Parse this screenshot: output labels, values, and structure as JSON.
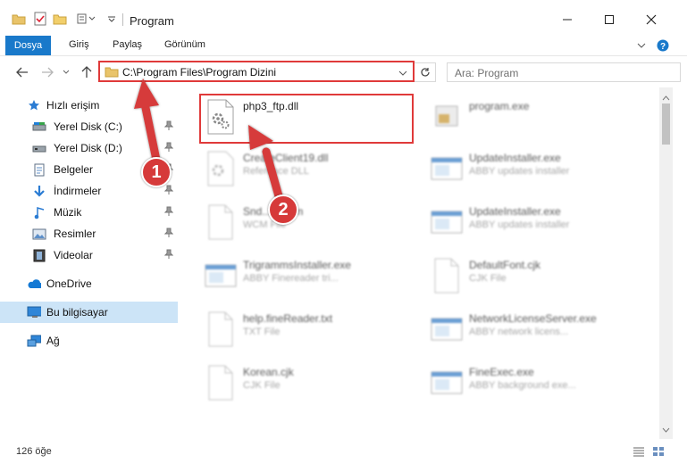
{
  "window": {
    "title": "Program",
    "controls": {
      "minimize": "minimize-icon",
      "maximize": "maximize-icon",
      "close": "close-icon"
    }
  },
  "ribbon": {
    "tabs": [
      "Dosya",
      "Giriş",
      "Paylaş",
      "Görünüm"
    ]
  },
  "address": {
    "path": "C:\\Program Files\\Program Dizini"
  },
  "search": {
    "placeholder": "Ara: Program"
  },
  "sidebar": {
    "items": [
      {
        "label": "Hızlı erişim",
        "icon": "star-icon",
        "pinned": false
      },
      {
        "label": "Yerel Disk (C:)",
        "icon": "drive-icon",
        "pinned": true
      },
      {
        "label": "Yerel Disk (D:)",
        "icon": "drive-icon",
        "pinned": true
      },
      {
        "label": "Belgeler",
        "icon": "document-icon",
        "pinned": true
      },
      {
        "label": "İndirmeler",
        "icon": "download-icon",
        "pinned": true
      },
      {
        "label": "Müzik",
        "icon": "music-icon",
        "pinned": true
      },
      {
        "label": "Resimler",
        "icon": "picture-icon",
        "pinned": true
      },
      {
        "label": "Videolar",
        "icon": "video-icon",
        "pinned": true
      },
      {
        "label": "OneDrive",
        "icon": "cloud-icon",
        "pinned": false
      },
      {
        "label": "Bu bilgisayar",
        "icon": "computer-icon",
        "pinned": false
      },
      {
        "label": "Ağ",
        "icon": "network-icon",
        "pinned": false
      }
    ]
  },
  "files": [
    {
      "name": "php3_ftp.dll",
      "desc": "",
      "icon": "dll-gear-icon"
    },
    {
      "name": "program.exe",
      "desc": "",
      "icon": "exe-icon"
    },
    {
      "name": "CreateClient19.dll",
      "desc": "Reference DLL",
      "icon": "dll-gear-icon"
    },
    {
      "name": "UpdateInstaller.exe",
      "desc": "ABBY updates installer",
      "icon": "window-exe-icon"
    },
    {
      "name": "Snd...S.wcm",
      "desc": "WCM File",
      "icon": "file-icon"
    },
    {
      "name": "UpdateInstaller.exe",
      "desc": "ABBY updates installer",
      "icon": "window-exe-icon"
    },
    {
      "name": "TrigrammsInstaller.exe",
      "desc": "ABBY Finereader tri...",
      "icon": "window-exe-icon"
    },
    {
      "name": "DefaultFont.cjk",
      "desc": "CJK File",
      "icon": "file-icon"
    },
    {
      "name": "help.fineReader.txt",
      "desc": "TXT File",
      "icon": "file-icon"
    },
    {
      "name": "NetworkLicenseServer.exe",
      "desc": "ABBY network licens...",
      "icon": "window-exe-icon"
    },
    {
      "name": "Korean.cjk",
      "desc": "CJK File",
      "icon": "file-icon"
    },
    {
      "name": "FineExec.exe",
      "desc": "ABBY background exe...",
      "icon": "window-exe-icon"
    }
  ],
  "status": {
    "count": "126 öğe"
  },
  "callouts": [
    "1",
    "2"
  ],
  "colors": {
    "accent": "#1979ca",
    "highlight": "#e03a3a",
    "selected": "#cce4f7"
  }
}
